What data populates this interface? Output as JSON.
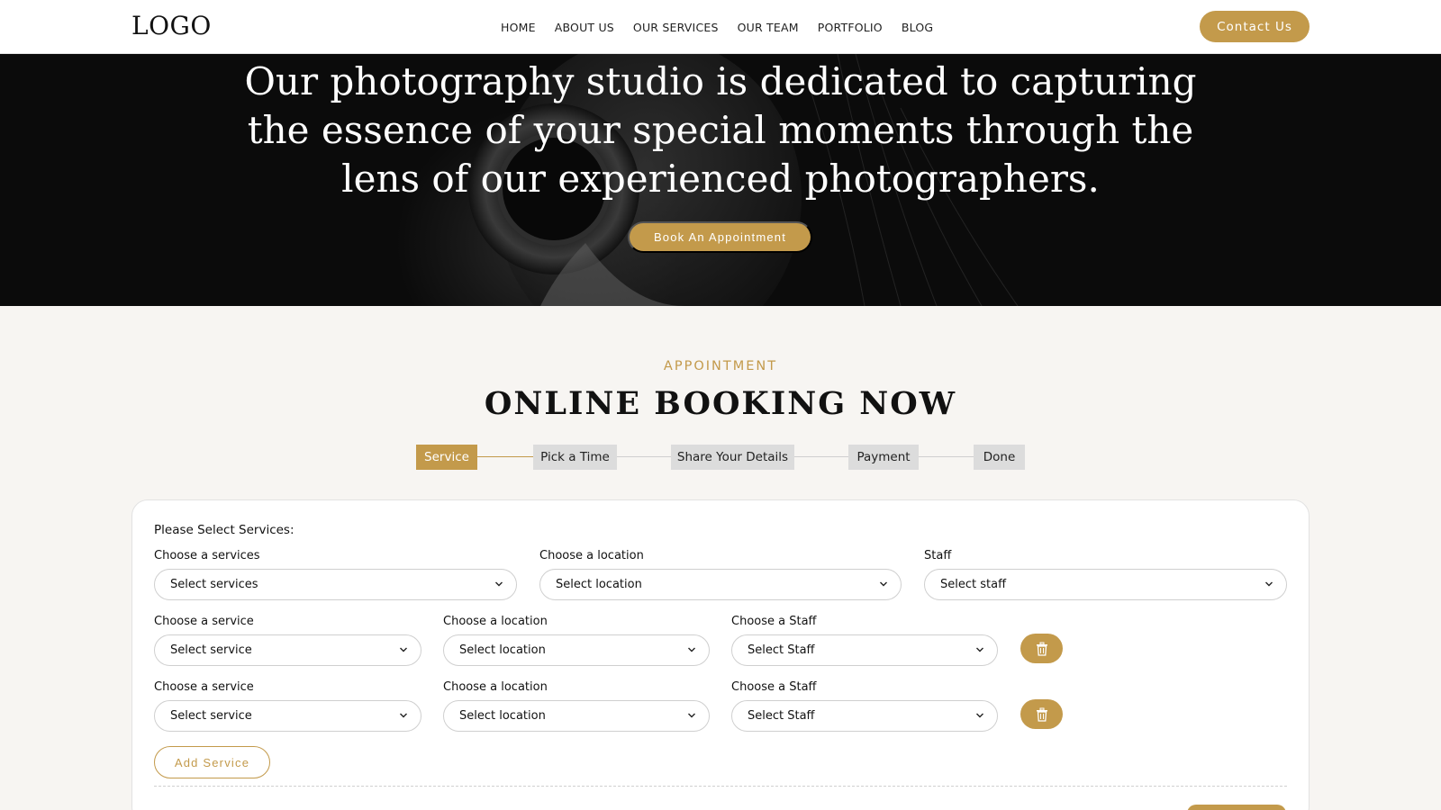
{
  "header": {
    "logo": "LOGO",
    "nav": [
      "HOME",
      "ABOUT US",
      "OUR SERVICES",
      "OUR TEAM",
      "PORTFOLIO",
      "BLOG"
    ],
    "contact_label": "Contact Us"
  },
  "hero": {
    "headline_lines": [
      "Our photography studio is dedicated to capturing",
      "the essence of your special moments through the",
      "lens of our experienced photographers."
    ],
    "cta_label": "Book An Appointment"
  },
  "section": {
    "eyebrow": "APPOINTMENT",
    "title": "ONLINE BOOKING NOW"
  },
  "steps": [
    {
      "label": "Service",
      "active": true
    },
    {
      "label": "Pick a Time",
      "active": false
    },
    {
      "label": "Share Your Details",
      "active": false
    },
    {
      "label": "Payment",
      "active": false
    },
    {
      "label": "Done",
      "active": false
    }
  ],
  "form": {
    "title": "Please Select Services:",
    "row1": {
      "service_label": "Choose a services",
      "service_value": "Select services",
      "location_label": "Choose a location",
      "location_value": "Select location",
      "staff_label": "Staff",
      "staff_value": "Select staff"
    },
    "extra_rows": [
      {
        "service_label": "Choose a service",
        "service_value": "Select service",
        "location_label": "Choose a location",
        "location_value": "Select location",
        "staff_label": "Choose a Staff",
        "staff_value": "Select Staff"
      },
      {
        "service_label": "Choose a service",
        "service_value": "Select service",
        "location_label": "Choose a location",
        "location_value": "Select location",
        "staff_label": "Choose a Staff",
        "staff_value": "Select Staff"
      }
    ],
    "add_label": "Add Service"
  },
  "colors": {
    "accent": "#c39a4b",
    "step_inactive": "#dcdcdc",
    "hero_bg": "#0d0d0d",
    "page_bg": "#f7f5f2"
  },
  "icons": {
    "chevron": "chevron-down-icon",
    "delete": "trash-icon"
  }
}
